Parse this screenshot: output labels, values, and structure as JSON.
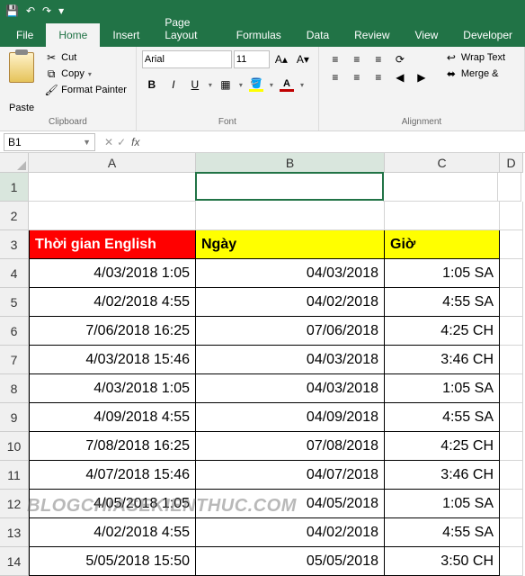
{
  "qat": {
    "save": "💾",
    "undo": "↶",
    "redo": "↷",
    "more": "▾"
  },
  "tabs": {
    "file": "File",
    "home": "Home",
    "insert": "Insert",
    "pagelayout": "Page Layout",
    "formulas": "Formulas",
    "data": "Data",
    "review": "Review",
    "view": "View",
    "developer": "Developer"
  },
  "ribbon": {
    "clipboard": {
      "paste": "Paste",
      "cut": "Cut",
      "copy": "Copy",
      "format_painter": "Format Painter",
      "label": "Clipboard"
    },
    "font": {
      "family": "Arial",
      "size": "11",
      "label": "Font",
      "bold": "B",
      "italic": "I",
      "underline": "U"
    },
    "alignment": {
      "wrap": "Wrap Text",
      "merge": "Merge &",
      "label": "Alignment"
    }
  },
  "namebox": "B1",
  "formula": "",
  "columns": [
    "A",
    "B",
    "C",
    "D"
  ],
  "rows": [
    {
      "n": "1",
      "a": "",
      "b": "",
      "c": ""
    },
    {
      "n": "2",
      "a": "",
      "b": "",
      "c": ""
    },
    {
      "n": "3",
      "a": "Thời gian English",
      "b": "Ngày",
      "c": "Giờ",
      "header": true
    },
    {
      "n": "4",
      "a": "4/03/2018 1:05",
      "b": "04/03/2018",
      "c": "1:05 SA"
    },
    {
      "n": "5",
      "a": "4/02/2018 4:55",
      "b": "04/02/2018",
      "c": "4:55 SA"
    },
    {
      "n": "6",
      "a": "7/06/2018 16:25",
      "b": "07/06/2018",
      "c": "4:25 CH"
    },
    {
      "n": "7",
      "a": "4/03/2018 15:46",
      "b": "04/03/2018",
      "c": "3:46 CH"
    },
    {
      "n": "8",
      "a": "4/03/2018 1:05",
      "b": "04/03/2018",
      "c": "1:05 SA"
    },
    {
      "n": "9",
      "a": "4/09/2018 4:55",
      "b": "04/09/2018",
      "c": "4:55 SA"
    },
    {
      "n": "10",
      "a": "7/08/2018 16:25",
      "b": "07/08/2018",
      "c": "4:25 CH"
    },
    {
      "n": "11",
      "a": "4/07/2018 15:46",
      "b": "04/07/2018",
      "c": "3:46 CH"
    },
    {
      "n": "12",
      "a": "4/05/2018 1:05",
      "b": "04/05/2018",
      "c": "1:05 SA"
    },
    {
      "n": "13",
      "a": "4/02/2018 4:55",
      "b": "04/02/2018",
      "c": "4:55 SA"
    },
    {
      "n": "14",
      "a": "5/05/2018 15:50",
      "b": "05/05/2018",
      "c": "3:50 CH"
    }
  ],
  "watermark": "BLOGCHIASEKIENTHUC.COM"
}
